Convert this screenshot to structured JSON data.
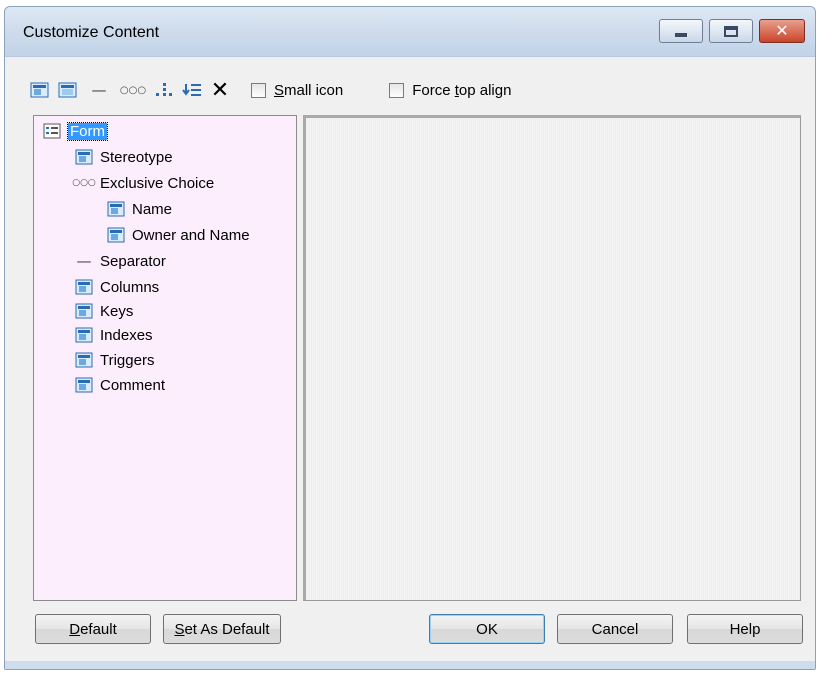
{
  "window": {
    "title": "Customize Content"
  },
  "toolbar": {
    "icons": [
      "attribute-icon",
      "collection-icon",
      "separator-icon",
      "exclusive-choice-icon",
      "add-child-icon",
      "insert-icon",
      "delete-icon"
    ],
    "separator_glyph": "—",
    "choice_glyph": "○○○",
    "delete_glyph": "✕",
    "small_icon": {
      "prefix": "",
      "underlined": "S",
      "rest": "mall icon",
      "checked": false
    },
    "force_top_align": {
      "prefix": "Force ",
      "underlined": "t",
      "rest": "op align",
      "checked": false
    }
  },
  "tree": {
    "items": [
      {
        "label": "Form",
        "icon": "form-icon",
        "level": 0,
        "selected": true
      },
      {
        "label": "Stereotype",
        "icon": "attribute-icon",
        "level": 1
      },
      {
        "label": "Exclusive Choice",
        "icon": "exclusive-choice-icon",
        "level": 1
      },
      {
        "label": "Name",
        "icon": "attribute-icon",
        "level": 2
      },
      {
        "label": "Owner and Name",
        "icon": "attribute-icon",
        "level": 2
      },
      {
        "label": "Separator",
        "icon": "separator-icon",
        "level": 1
      },
      {
        "label": "Columns",
        "icon": "attribute-icon",
        "level": 1
      },
      {
        "label": "Keys",
        "icon": "attribute-icon",
        "level": 1
      },
      {
        "label": "Indexes",
        "icon": "attribute-icon",
        "level": 1
      },
      {
        "label": "Triggers",
        "icon": "attribute-icon",
        "level": 1
      },
      {
        "label": "Comment",
        "icon": "attribute-icon",
        "level": 1
      }
    ]
  },
  "buttons": {
    "default": {
      "underlined": "D",
      "rest": "efault"
    },
    "set_as_default": {
      "underlined": "S",
      "rest": "et As Default"
    },
    "ok": "OK",
    "cancel": "Cancel",
    "help": "Help"
  },
  "colors": {
    "tree_bg": "#fdeefe",
    "selection": "#3399ff",
    "titlebar": "#cfdcec"
  }
}
